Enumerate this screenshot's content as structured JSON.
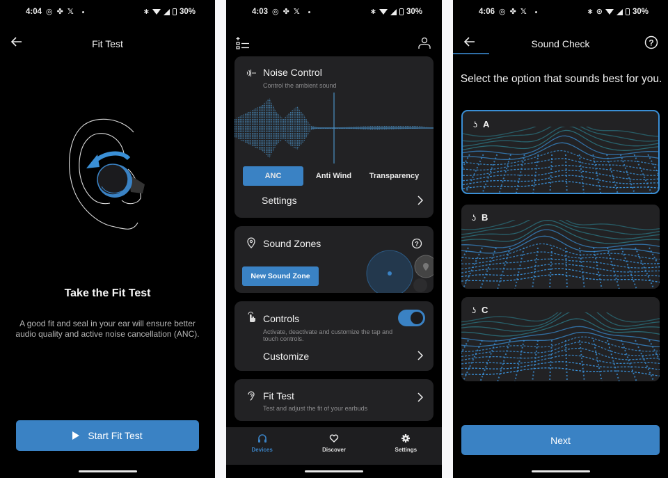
{
  "screens": [
    {
      "status": {
        "time": "4:04",
        "battery": "30%",
        "icons": [
          "instagram-icon",
          "pinwheel-icon",
          "x-icon",
          "notification-dot",
          "bluetooth-icon",
          "wifi-icon",
          "signal-icon",
          "battery-icon"
        ]
      },
      "header": {
        "title": "Fit Test",
        "back_icon": "back-arrow-icon"
      },
      "heading": "Take the Fit Test",
      "description": "A good fit and seal in your ear will ensure better audio quality and active noise cancellation (ANC).",
      "primary_button": {
        "label": "Start Fit Test",
        "icon": "play-icon"
      }
    },
    {
      "status": {
        "time": "4:03",
        "battery": "30%",
        "icons": [
          "instagram-icon",
          "pinwheel-icon",
          "x-icon",
          "notification-dot",
          "bluetooth-icon",
          "wifi-icon",
          "signal-icon",
          "battery-icon"
        ]
      },
      "header": {
        "left_icon": "add-device-list-icon",
        "right_icon": "profile-icon"
      },
      "noise_control": {
        "title": "Noise Control",
        "subtitle": "Control the ambient sound",
        "modes": [
          "ANC",
          "Anti Wind",
          "Transparency"
        ],
        "selected_mode": "ANC",
        "settings_label": "Settings"
      },
      "sound_zones": {
        "title": "Sound Zones",
        "button": "New Sound Zone"
      },
      "controls": {
        "title": "Controls",
        "subtitle": "Activate, deactivate and customize the tap and touch controls.",
        "enabled": true,
        "customize_label": "Customize"
      },
      "fit_test": {
        "title": "Fit Test",
        "subtitle": "Test and adjust the fit of your earbuds"
      },
      "bottom_nav": [
        {
          "label": "Devices",
          "icon": "headphones-icon",
          "active": true
        },
        {
          "label": "Discover",
          "icon": "heart-icon",
          "active": false
        },
        {
          "label": "Settings",
          "icon": "gear-icon",
          "active": false
        }
      ]
    },
    {
      "status": {
        "time": "4:06",
        "battery": "30%",
        "icons": [
          "instagram-icon",
          "pinwheel-icon",
          "x-icon",
          "notification-dot",
          "bluetooth-icon",
          "location-icon",
          "wifi-icon",
          "signal-icon",
          "battery-icon"
        ]
      },
      "header": {
        "title": "Sound Check",
        "help_icon": "help-icon"
      },
      "prompt": "Select the option that sounds best for you.",
      "options": [
        {
          "label": "A",
          "selected": true
        },
        {
          "label": "B",
          "selected": false
        },
        {
          "label": "C",
          "selected": false
        }
      ],
      "primary_button": {
        "label": "Next"
      }
    }
  ],
  "colors": {
    "accent": "#3a82c4",
    "card": "#222224",
    "background": "#000000",
    "gap": "#f7f7f9"
  }
}
